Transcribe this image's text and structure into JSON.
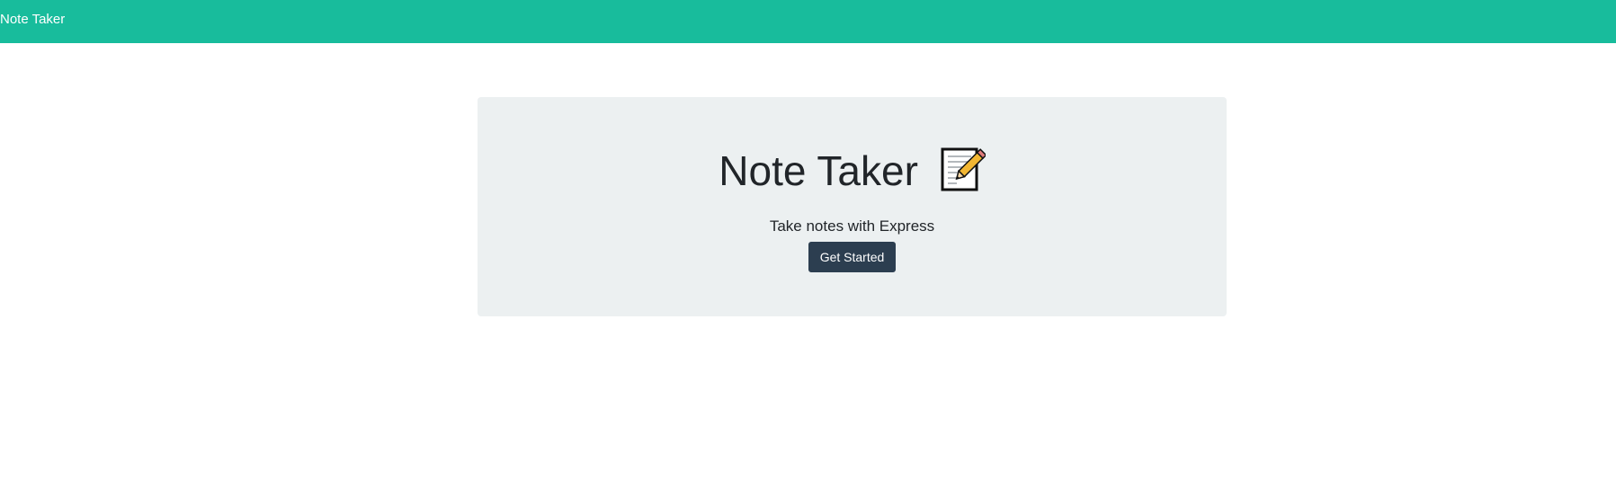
{
  "navbar": {
    "brand": "Note Taker",
    "color": "#18bc9c"
  },
  "jumbotron": {
    "title": "Note Taker",
    "title_icon": "memo-icon",
    "lead": "Take notes with Express",
    "button_label": "Get Started",
    "background": "#ecf0f1",
    "button_color": "#2c3e50"
  }
}
